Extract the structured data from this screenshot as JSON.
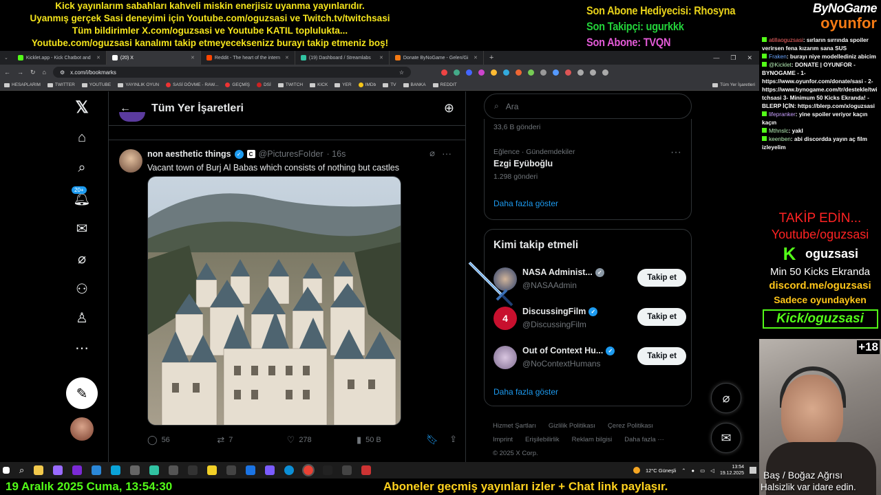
{
  "overlay": {
    "lines": [
      "Kick yayınlarım sabahları kahveli miskin enerjisiz uyanma yayınlarıdır.",
      "Uyanmış gerçek Sasi deneyimi için Youtube.com/oguzsasi ve Twitch.tv/twitchsasi",
      "Tüm bildirimler X.com/oguzsasi ve Youtube KATIL topluluktа...",
      "Youtube.com/oguzsasi kanalımı takip etmeyeceksenizz burayı takip etmeniz boş!"
    ],
    "stats": {
      "last_gift": "Son Abone Hediyecisi: Rhosyna",
      "last_follower": "Son Takipçi: ugurkkk",
      "last_sub": "Son Abone: TVQN"
    },
    "brand_top": "ByNoGame",
    "brand_bottom": "oyunfor",
    "bottom_date": "19 Aralık 2025 Cuma, 13:54:30",
    "bottom_ticker": "Aboneler geçmiş yayınları izler + Chat link paylaşır."
  },
  "browser": {
    "tabs": [
      {
        "label": "Kicklet.app - Kick Chatbot and",
        "color": "#53fc18"
      },
      {
        "label": "(20) X",
        "color": "#ffffff"
      },
      {
        "label": "Reddit - The heart of the intern",
        "color": "#ff4500"
      },
      {
        "label": "(19) Dashboard / Streamlabs",
        "color": "#31c3a2"
      },
      {
        "label": "Donate ByNoGame - Gelen/Gi",
        "color": "#f47a14"
      }
    ],
    "url": "x.com/i/bookmarks",
    "bookmarks": [
      "HESAPLARIM",
      "TWITTER",
      "YOUTUBE",
      "YAYINLIK OYUN",
      "SASİ DÖVME - RAW...",
      "GEÇMİŞ",
      "DSİ",
      "TWITCH",
      "KICK",
      "YER",
      "IMDb",
      "TV",
      "BANKA",
      "REDDIT",
      "Tüm Yer İşaretleri"
    ]
  },
  "x": {
    "notif_badge": "20+",
    "header_title": "Tüm Yer İşaretleri",
    "tweet": {
      "name": "non aesthetic things",
      "handle": "@PicturesFoIder",
      "time": "· 16s",
      "text": "Vacant town of Burj Al Babas which consists of nothing but castles",
      "replies": "56",
      "reposts": "7",
      "likes": "278",
      "views": "50 B"
    },
    "search_placeholder": "Ara",
    "trends": {
      "prev_count": "33,6 B gönderi",
      "category": "Eğlence · Gündemdekiler",
      "name": "Ezgi Eyüboğlu",
      "count": "1.298 gönderi",
      "show_more": "Daha fazla göster"
    },
    "who_to_follow": {
      "title": "Kimi takip etmeli",
      "follow_label": "Takip et",
      "accounts": [
        {
          "name": "NASA Administ...",
          "handle": "@NASAAdmin",
          "color": "#2b3f6b"
        },
        {
          "name": "DiscussingFilm",
          "handle": "@DiscussingFilm",
          "color": "#c8102e"
        },
        {
          "name": "Out of Context Hu...",
          "handle": "@NoContextHumans",
          "color": "#7d6a8f"
        }
      ],
      "show_more": "Daha fazla göster"
    },
    "footer": [
      "Hizmet Şartları",
      "Gizlilik Politikası",
      "Çerez Politikası",
      "Imprint",
      "Erişilebilirlik",
      "Reklam bilgisi",
      "Daha fazla ···",
      "© 2025 X Corp."
    ]
  },
  "chat": {
    "messages": [
      {
        "user": "atillaoguzsasi",
        "cls": "r",
        "text": ": sırların sırrında spoiler verirsen fena kızarım sana SUS"
      },
      {
        "user": "Fraken",
        "cls": "",
        "text": ": burayı niye modellediniz abicim"
      },
      {
        "user": "@Kicklet",
        "cls": "g",
        "text": ": DONATE | OYUNFOR - BYNOGAME - 1- https://www.oyunfor.com/donate/sasi - 2- https://www.bynogame.com/tr/destekle/twitchsasi 3- Minimum 50 Kicks Ekranda! - BLERP İÇİN: https://blerp.com/x/oguzsasi"
      },
      {
        "user": "lifepranker",
        "cls": "p",
        "text": ": yine spoiler veriyor kaçın kaçın"
      },
      {
        "user": "Mthnslc",
        "cls": "g",
        "text": ": yakl"
      },
      {
        "user": "keenben",
        "cls": "g",
        "text": ": abi discordda yayın aç film izleyelim"
      }
    ],
    "promo": {
      "follow": "TAKİP EDİN...",
      "youtube": "Youtube/oguzsasi",
      "kick_name": "oguzsasi",
      "min_kicks": "Min 50 Kicks Ekranda",
      "discord": "discord.me/oguzsasi",
      "only_game": "Sadece oyundayken",
      "kick_link": "Kick/oguzsasi"
    },
    "cam_badge": "+18",
    "caption1": "Baş / Boğaz Ağrısı",
    "caption2": "Halsizlik var idare edin."
  },
  "taskbar": {
    "weather": "12°C Güneşli",
    "time": "13:54",
    "date": "19.12.2025"
  }
}
